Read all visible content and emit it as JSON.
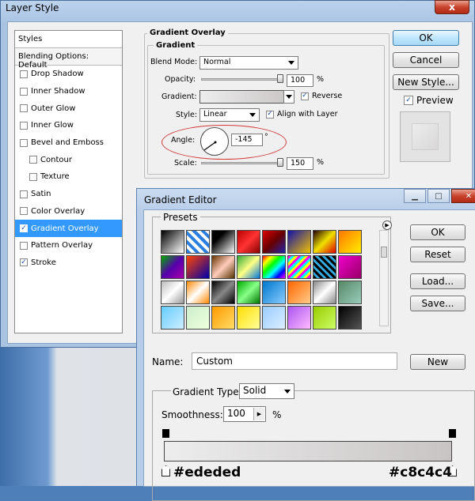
{
  "layer_style": {
    "title": "Layer Style",
    "close_label": "x",
    "styles_header": "Styles",
    "blending_options": "Blending Options: Default",
    "styles": [
      {
        "label": "Drop Shadow",
        "checked": false,
        "indent": false,
        "selected": false
      },
      {
        "label": "Inner Shadow",
        "checked": false,
        "indent": false,
        "selected": false
      },
      {
        "label": "Outer Glow",
        "checked": false,
        "indent": false,
        "selected": false
      },
      {
        "label": "Inner Glow",
        "checked": false,
        "indent": false,
        "selected": false
      },
      {
        "label": "Bevel and Emboss",
        "checked": false,
        "indent": false,
        "selected": false
      },
      {
        "label": "Contour",
        "checked": false,
        "indent": true,
        "selected": false
      },
      {
        "label": "Texture",
        "checked": false,
        "indent": true,
        "selected": false
      },
      {
        "label": "Satin",
        "checked": false,
        "indent": false,
        "selected": false
      },
      {
        "label": "Color Overlay",
        "checked": false,
        "indent": false,
        "selected": false
      },
      {
        "label": "Gradient Overlay",
        "checked": true,
        "indent": false,
        "selected": true
      },
      {
        "label": "Pattern Overlay",
        "checked": false,
        "indent": false,
        "selected": false
      },
      {
        "label": "Stroke",
        "checked": true,
        "indent": false,
        "selected": false
      }
    ],
    "panel": {
      "title": "Gradient Overlay",
      "group": "Gradient",
      "blend_mode_label": "Blend Mode:",
      "blend_mode_value": "Normal",
      "opacity_label": "Opacity:",
      "opacity_value": "100",
      "opacity_fraction": 1.0,
      "percent": "%",
      "gradient_label": "Gradient:",
      "reverse_label": "Reverse",
      "reverse_checked": true,
      "style_label": "Style:",
      "style_value": "Linear",
      "align_label": "Align with Layer",
      "align_checked": true,
      "angle_label": "Angle:",
      "angle_value": "-145",
      "degree": "°",
      "scale_label": "Scale:",
      "scale_value": "150",
      "scale_fraction": 1.0
    },
    "buttons": {
      "ok": "OK",
      "cancel": "Cancel",
      "new_style": "New Style...",
      "preview_label": "Preview",
      "preview_checked": true
    }
  },
  "gradient_editor": {
    "title": "Gradient Editor",
    "presets_label": "Presets",
    "buttons": {
      "ok": "OK",
      "reset": "Reset",
      "load": "Load...",
      "save": "Save...",
      "new": "New"
    },
    "name_label": "Name:",
    "name_value": "Custom",
    "gradient_type_label": "Gradient Type:",
    "gradient_type_value": "Solid",
    "smoothness_label": "Smoothness:",
    "smoothness_value": "100",
    "percent": "%",
    "left_color_label": "#ededed",
    "right_color_label": "#c8c4c4",
    "left_color": "#ededed",
    "right_color": "#c8c4c4",
    "preset_swatches": [
      "linear-gradient(135deg,#000,#fff)",
      "repeating-linear-gradient(45deg,#2a7fe0 0 4px,#fff 4px 8px)",
      "linear-gradient(135deg,#000 30%,#fff)",
      "linear-gradient(135deg,#b00,#f33,#800)",
      "linear-gradient(135deg,#d00,#600,#22a)",
      "linear-gradient(135deg,#11a,#f0c000)",
      "linear-gradient(135deg,#200,#f0e000,#d00)",
      "linear-gradient(135deg,#f70,#fe0)",
      "linear-gradient(135deg,#0a0,#50a,#a0a)",
      "linear-gradient(135deg,#f40,#00a)",
      "linear-gradient(135deg,#630,#fcb,#530)",
      "linear-gradient(135deg,#3a3,#ff8,#07d)",
      "linear-gradient(135deg,#f00,#ff0,#0f0,#0ff,#00f,#f0f)",
      "repeating-linear-gradient(135deg,#f0f 0 3px,#0ff 3px 6px,#ff0 6px 9px)",
      "repeating-linear-gradient(45deg,#000 0 3px,#3ad 3px 6px)",
      "linear-gradient(135deg,#e0c,#906)",
      "linear-gradient(135deg,#bbb,#fff,#999)",
      "linear-gradient(135deg,#f80,#fff,#f80)",
      "linear-gradient(135deg,#000,#888,#000)",
      "linear-gradient(135deg,#0a0,#8f8,#070)",
      "linear-gradient(135deg,#07c,#8cf)",
      "linear-gradient(135deg,#f60,#fc8)",
      "linear-gradient(135deg,#888,#fff,#888)",
      "linear-gradient(135deg,#586,#9cb)",
      "linear-gradient(135deg,#6cf,#cef)",
      "linear-gradient(135deg,#cec,#efd)",
      "linear-gradient(135deg,#f90,#fd6)",
      "linear-gradient(135deg,#fd0,#ff9)",
      "linear-gradient(135deg,#9cf,#def)",
      "linear-gradient(135deg,#a5e,#fbf)",
      "linear-gradient(135deg,#9c0,#cf6)",
      "linear-gradient(135deg,#000,#555)"
    ]
  }
}
